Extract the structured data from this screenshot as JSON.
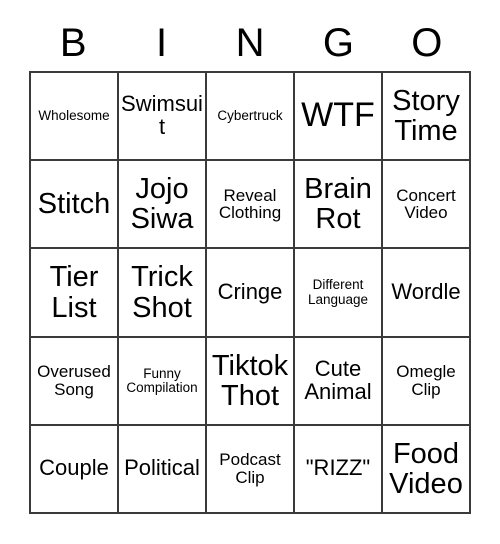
{
  "card": {
    "header_letters": [
      "B",
      "I",
      "N",
      "G",
      "O"
    ],
    "columns": 5,
    "rows": 5,
    "colors": {
      "background": "#ffffff",
      "text": "#000000",
      "gridline": "#3a3a3a"
    },
    "cells": [
      [
        {
          "text": "Wholesome",
          "size": "xs"
        },
        {
          "text": "Swimsuit",
          "size": "md"
        },
        {
          "text": "Cybertruck",
          "size": "xs"
        },
        {
          "text": "WTF",
          "size": "xl"
        },
        {
          "text": "Story Time",
          "size": "lg"
        }
      ],
      [
        {
          "text": "Stitch",
          "size": "lg"
        },
        {
          "text": "Jojo Siwa",
          "size": "lg"
        },
        {
          "text": "Reveal Clothing",
          "size": "sm"
        },
        {
          "text": "Brain Rot",
          "size": "lg"
        },
        {
          "text": "Concert Video",
          "size": "sm"
        }
      ],
      [
        {
          "text": "Tier List",
          "size": "lg"
        },
        {
          "text": "Trick Shot",
          "size": "lg"
        },
        {
          "text": "Cringe",
          "size": "md"
        },
        {
          "text": "Different Language",
          "size": "xs"
        },
        {
          "text": "Wordle",
          "size": "md"
        }
      ],
      [
        {
          "text": "Overused Song",
          "size": "sm"
        },
        {
          "text": "Funny Compilation",
          "size": "xs"
        },
        {
          "text": "Tiktok Thot",
          "size": "lg"
        },
        {
          "text": "Cute Animal",
          "size": "md"
        },
        {
          "text": "Omegle Clip",
          "size": "sm"
        }
      ],
      [
        {
          "text": "Couple",
          "size": "md"
        },
        {
          "text": "Political",
          "size": "md"
        },
        {
          "text": "Podcast Clip",
          "size": "sm"
        },
        {
          "text": "\"RIZZ\"",
          "size": "md"
        },
        {
          "text": "Food Video",
          "size": "lg"
        }
      ]
    ]
  }
}
